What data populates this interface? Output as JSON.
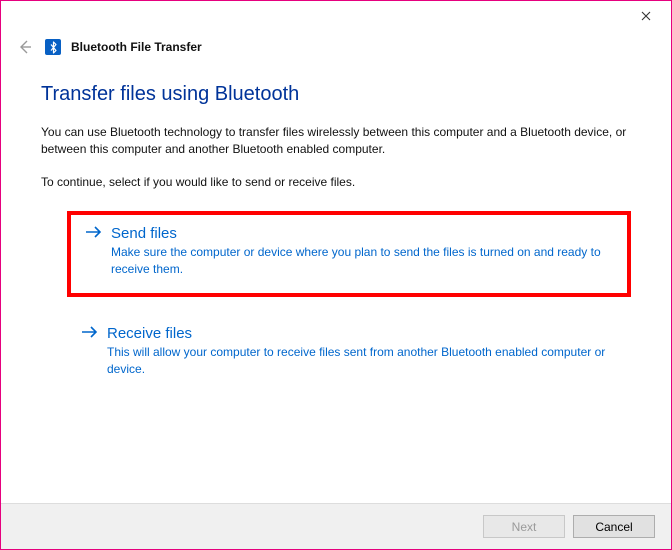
{
  "titlebar": {
    "close": "×"
  },
  "header": {
    "wizard_title": "Bluetooth File Transfer"
  },
  "page": {
    "heading": "Transfer files using Bluetooth",
    "intro": "You can use Bluetooth technology to transfer files wirelessly between this computer and a Bluetooth device, or between this computer and another Bluetooth enabled computer.",
    "instruction": "To continue, select if you would like to send or receive files."
  },
  "options": {
    "send": {
      "title": "Send files",
      "desc": "Make sure the computer or device where you plan to send the files is turned on and ready to receive them."
    },
    "receive": {
      "title": "Receive files",
      "desc": "This will allow your computer to receive files sent from another Bluetooth enabled computer or device."
    }
  },
  "footer": {
    "next": "Next",
    "cancel": "Cancel"
  }
}
